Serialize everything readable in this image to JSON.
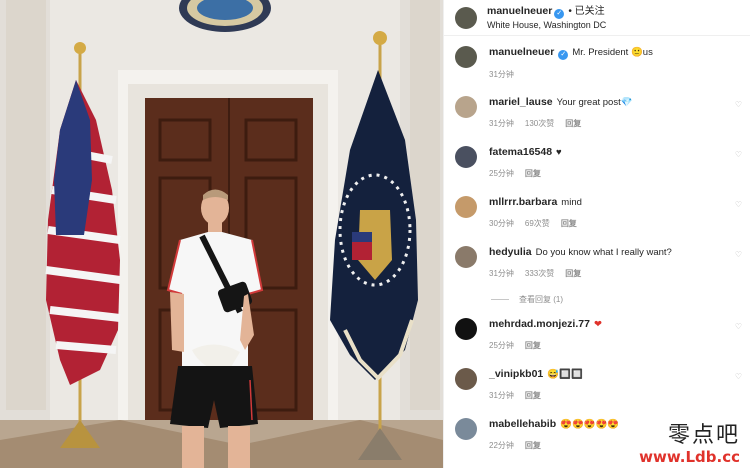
{
  "post": {
    "author": "manuelneuer",
    "verified_icon": "verified-badge-icon",
    "follow_status": "• 已关注",
    "location": "White House, Washington DC"
  },
  "photo": {
    "description_icon": "photo-icon",
    "seal_text": "SEA"
  },
  "comments": [
    {
      "user": "manuelneuer",
      "verified": true,
      "text": "Mr. President 🙂us",
      "time": "31分钟",
      "likes": "",
      "reply": "",
      "avatar_color": "#5a5a4e"
    },
    {
      "user": "mariel_lause",
      "verified": false,
      "text": "Your great post💎",
      "time": "31分钟",
      "likes": "130次赞",
      "reply": "回复",
      "avatar_color": "#b8a48c"
    },
    {
      "user": "fatema16548",
      "verified": false,
      "text": "♥",
      "time": "25分钟",
      "likes": "",
      "reply": "回复",
      "avatar_color": "#4a5060"
    },
    {
      "user": "mllrrr.barbara",
      "verified": false,
      "text": "mind",
      "time": "30分钟",
      "likes": "69次赞",
      "reply": "回复",
      "avatar_color": "#c59a6a"
    },
    {
      "user": "hedyulia",
      "verified": false,
      "text": "Do you know what I really want?",
      "time": "31分钟",
      "likes": "333次赞",
      "reply": "回复",
      "avatar_color": "#8a7a6a"
    },
    {
      "user": "mehrdad.monjezi.77",
      "verified": false,
      "text": "❤",
      "time": "25分钟",
      "likes": "",
      "reply": "回复",
      "avatar_color": "#111111"
    },
    {
      "user": "_vinipkb01",
      "verified": false,
      "text": "😅🔲🔲",
      "time": "31分钟",
      "likes": "",
      "reply": "回复",
      "avatar_color": "#6b5a4a"
    },
    {
      "user": "mabellehabib",
      "verified": false,
      "text": "😍😍😍😍😍",
      "time": "22分钟",
      "likes": "",
      "reply": "回复",
      "avatar_color": "#7a8a9a"
    }
  ],
  "view_replies": "查看回复 (1)",
  "watermark": {
    "cn": "零点吧",
    "url": "www.Ldb.cc"
  },
  "colors": {
    "verified": "#3897f0",
    "meta": "#8e8e8e",
    "text": "#262626"
  }
}
